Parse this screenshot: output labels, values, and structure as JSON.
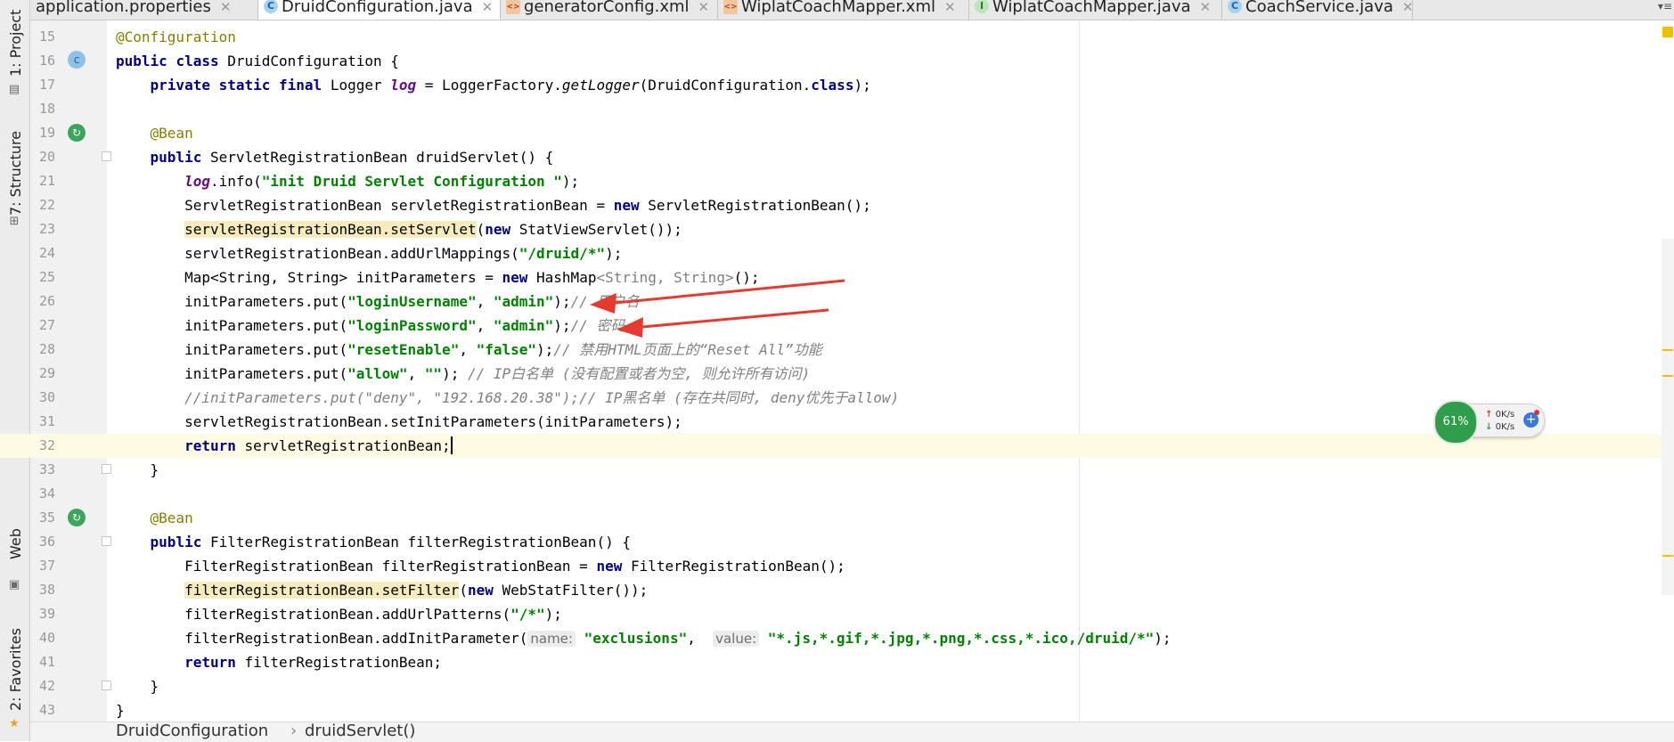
{
  "tabs": [
    {
      "label": "application.properties",
      "icon": "properties-file-icon",
      "active": false
    },
    {
      "label": "DruidConfiguration.java",
      "icon": "class-icon",
      "active": true
    },
    {
      "label": "generatorConfig.xml",
      "icon": "xml-file-icon",
      "active": false
    },
    {
      "label": "WiplatCoachMapper.xml",
      "icon": "xml-file-icon",
      "active": false
    },
    {
      "label": "WiplatCoachMapper.java",
      "icon": "interface-icon",
      "active": false
    },
    {
      "label": "CoachService.java",
      "icon": "class-icon",
      "active": false
    }
  ],
  "tool_windows": {
    "project": "1: Project",
    "structure": "7: Structure",
    "web": "Web",
    "favorites": "2: Favorites"
  },
  "code_lines": [
    {
      "num": "15"
    },
    {
      "num": "16"
    },
    {
      "num": "17"
    },
    {
      "num": "18"
    },
    {
      "num": "19"
    },
    {
      "num": "20"
    },
    {
      "num": "21"
    },
    {
      "num": "22"
    },
    {
      "num": "23"
    },
    {
      "num": "24"
    },
    {
      "num": "25"
    },
    {
      "num": "26"
    },
    {
      "num": "27"
    },
    {
      "num": "28"
    },
    {
      "num": "29"
    },
    {
      "num": "30"
    },
    {
      "num": "31"
    },
    {
      "num": "32"
    },
    {
      "num": "33"
    },
    {
      "num": "34"
    },
    {
      "num": "35"
    },
    {
      "num": "36"
    },
    {
      "num": "37"
    },
    {
      "num": "38"
    },
    {
      "num": "39"
    },
    {
      "num": "40"
    },
    {
      "num": "41"
    },
    {
      "num": "42"
    },
    {
      "num": "43"
    }
  ],
  "code": {
    "t": {
      "l15_ann": "@Configuration",
      "kw_public": "public",
      "kw_class": "class",
      "l16_name": " DruidConfiguration {",
      "kw_private_static_final": "private static final",
      "l17_a": " Logger ",
      "l17_log": "log",
      "l17_b": " = LoggerFactory.",
      "l17_get": "getLogger",
      "l17_c": "(DruidConfiguration.",
      "l17_d": ");",
      "ann_bean": "@Bean",
      "l20_a": " ServletRegistrationBean druidServlet() {",
      "l21_a": ".info(",
      "l21_str": "\"init Druid Servlet Configuration \"",
      "l21_b": ");",
      "l22_a": "ServletRegistrationBean servletRegistrationBean = ",
      "kw_new": "new",
      "l22_b": " ServletRegistrationBean();",
      "l23_hl": "servletRegistrationBean.setServlet",
      "l23_a": "(",
      "l23_b": " StatViewServlet());",
      "l24_a": "servletRegistrationBean.addUrlMappings(",
      "l24_str": "\"/druid/*\"",
      "l24_b": ");",
      "l25_a": "Map<String, String> initParameters = ",
      "l25_b": " HashMap",
      "l25_gen": "<String, String>",
      "l25_c": "();",
      "put_a": "initParameters.put(",
      "l26_k": "\"loginUsername\"",
      "comma": ", ",
      "l26_v": "\"admin\"",
      "semi_close": ");",
      "l26_cmt": "// 用户名",
      "l27_k": "\"loginPassword\"",
      "l27_v": "\"admin\"",
      "l27_cmt": "// 密码",
      "l28_k": "\"resetEnable\"",
      "l28_v": "\"false\"",
      "l28_cmt": "// 禁用HTML页面上的“Reset All”功能",
      "l29_k": "\"allow\"",
      "l29_v": "\"\"",
      "l29_b": "); ",
      "l29_cmt": "// IP白名单 (没有配置或者为空, 则允许所有访问)",
      "l30_cmt": "//initParameters.put(\"deny\", \"192.168.20.38\");// IP黑名单 (存在共同时, deny优先于allow)",
      "l31_a": "servletRegistrationBean.setInitParameters(initParameters);",
      "kw_return": "return",
      "l32_a": " servletRegistrationBean;",
      "close_brace": "}",
      "l36_a": " FilterRegistrationBean filterRegistrationBean() {",
      "l37_a": "FilterRegistrationBean filterRegistrationBean = ",
      "l37_b": " FilterRegistrationBean();",
      "l38_hl": "filterRegistrationBean.setFilter",
      "l38_b": " WebStatFilter());",
      "l39_a": "filterRegistrationBean.addUrlPatterns(",
      "l39_str": "\"/*\"",
      "l40_a": "filterRegistrationBean.addInitParameter(",
      "l40_h1": "name:",
      "l40_s1": "\"exclusions\"",
      "l40_h2": "value:",
      "l40_s2": "\"*.js,*.gif,*.jpg,*.png,*.css,*.ico,/druid/*\"",
      "l41_a": " filterRegistrationBean;"
    }
  },
  "breadcrumb": {
    "class_name": "DruidConfiguration",
    "separator": "›",
    "method_name": "druidServlet()"
  },
  "network_widget": {
    "percent": "61%",
    "upload": "0K/s",
    "download": "0K/s",
    "add": "+"
  },
  "gutter_icon_labels": {
    "class_marker": "c",
    "bean_marker": "↻"
  },
  "colors": {
    "keyword": "#000080",
    "string": "#008000",
    "annotation": "#808000",
    "comment": "#808080",
    "field": "#660e7a",
    "annotation_arrow": "#e53a2f"
  }
}
